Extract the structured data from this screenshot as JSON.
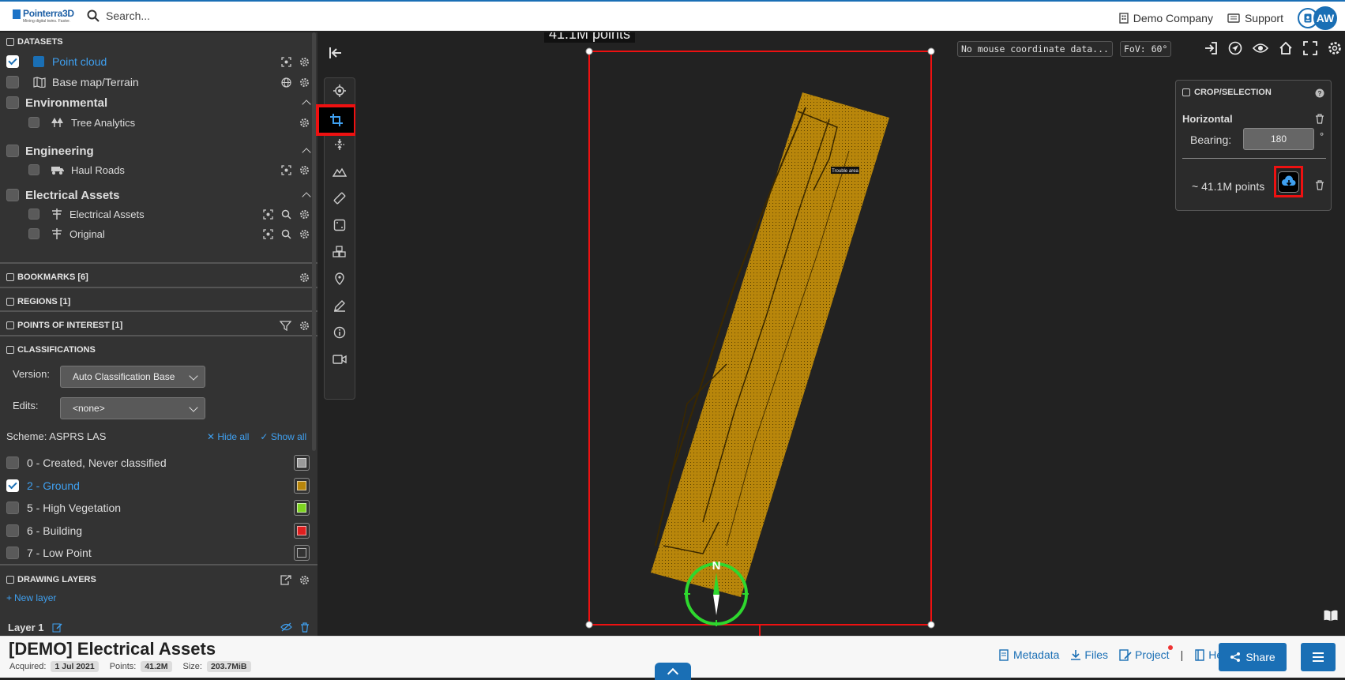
{
  "topbar": {
    "logo_name": "Pointerra3D",
    "logo_tagline": "Mining digital twins. Faster.",
    "search_placeholder": "Search...",
    "company": "Demo Company",
    "support": "Support",
    "avatar_initials": "AW"
  },
  "sidebar": {
    "datasets_header": "DATASETS",
    "datasets": [
      {
        "label": "Point cloud",
        "checked": true
      },
      {
        "label": "Base map/Terrain",
        "checked": false
      }
    ],
    "groups": [
      {
        "label": "Environmental",
        "children": [
          "Tree Analytics"
        ]
      },
      {
        "label": "Engineering",
        "children": [
          "Haul Roads"
        ]
      },
      {
        "label": "Electrical Assets",
        "children": [
          "Electrical Assets",
          "Original"
        ]
      }
    ],
    "bookmarks_header": "BOOKMARKS [6]",
    "regions_header": "REGIONS [1]",
    "poi_header": "POINTS OF INTEREST [1]",
    "classifications_header": "CLASSIFICATIONS",
    "version_label": "Version:",
    "version_value": "Auto Classification Base",
    "edits_label": "Edits:",
    "edits_value": "<none>",
    "scheme": "Scheme: ASPRS LAS",
    "hide_all": "Hide all",
    "show_all": "Show all",
    "classes": [
      {
        "label": "0 - Created, Never classified",
        "checked": false,
        "color": "#9a9a9a"
      },
      {
        "label": "2 - Ground",
        "checked": true,
        "color": "#b8860b"
      },
      {
        "label": "5 - High Vegetation",
        "checked": false,
        "color": "#7ed321"
      },
      {
        "label": "6 - Building",
        "checked": false,
        "color": "#e02020"
      },
      {
        "label": "7 - Low Point",
        "checked": false,
        "color": "#333333"
      }
    ],
    "drawing_layers_header": "DRAWING LAYERS",
    "new_layer": "New layer",
    "layer1": "Layer 1"
  },
  "viewport": {
    "points_overlay": "41.1M points",
    "mouse_coord": "No mouse coordinate data...",
    "fov": "FoV: 60°",
    "tag_label": "Trouble area",
    "compass_n": "N"
  },
  "crop_panel": {
    "title": "CROP/SELECTION",
    "mode": "Horizontal",
    "bearing_label": "Bearing:",
    "bearing_value": "180",
    "bearing_unit": "°",
    "points_estimate": "~ 41.1M points"
  },
  "footer": {
    "dataset_title": "[DEMO] Electrical Assets",
    "acquired_label": "Acquired:",
    "acquired_value": "1 Jul 2021",
    "points_label": "Points:",
    "points_value": "41.2M",
    "size_label": "Size:",
    "size_value": "203.7MiB",
    "metadata": "Metadata",
    "files": "Files",
    "project": "Project",
    "help": "Help",
    "share": "Share"
  },
  "colors": {
    "accent": "#1a6fb5",
    "highlight": "#ee1111",
    "ground": "#b8860b"
  }
}
